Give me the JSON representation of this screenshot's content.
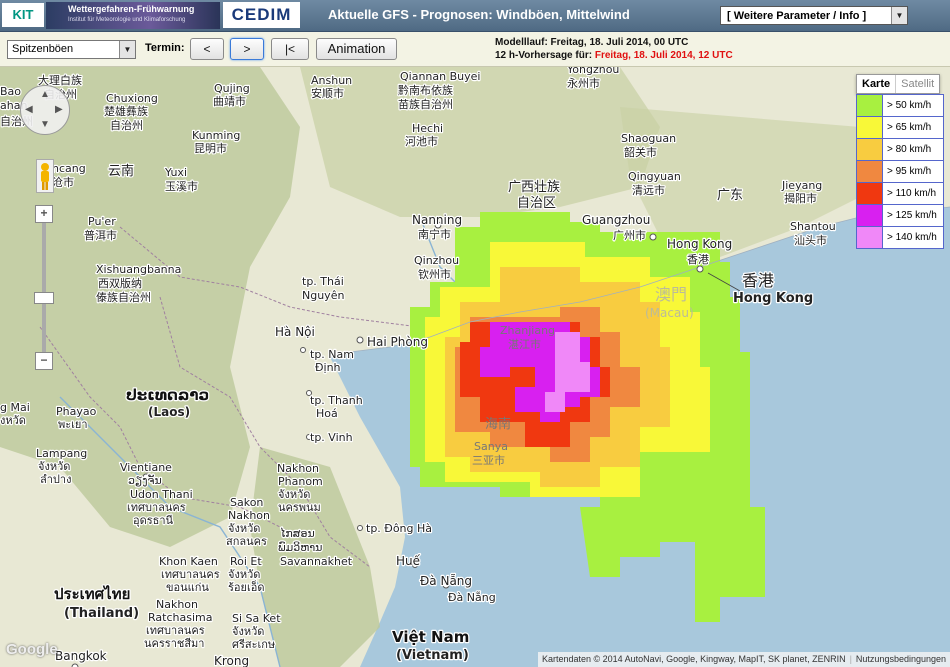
{
  "header": {
    "kit_logo": "KIT",
    "banner_title": "Wettergefahren-Frühwarnung",
    "banner_subtitle": "Institut für Meteorologie und Klimaforschung",
    "cedim_logo": "CEDIM",
    "page_title": "Aktuelle GFS - Prognosen: Windböen, Mittelwind",
    "param_select": "[ Weitere Parameter / Info ]"
  },
  "controls": {
    "variable": "Spitzenböen",
    "termin_label": "Termin:",
    "prev": "<",
    "next": ">",
    "first": "|<",
    "animation": "Animation",
    "run_label": "Modelllauf: Freitag, 18. Juli 2014, 00 UTC",
    "forecast_prefix": "12 h-Vorhersage für:",
    "forecast_time": "Freitag, 18. Juli 2014, 12 UTC"
  },
  "map": {
    "type_tabs": [
      "Karte",
      "Satellit"
    ],
    "zoom_in": "+",
    "zoom_out": "−",
    "google_logo": "Google",
    "attribution": "Kartendaten © 2014 AutoNavi, Google, Kingway, MapIT, SK planet, ZENRIN",
    "terms": "Nutzungsbedingungen",
    "labels": {
      "dali": "大理白族",
      "dali2": "自治州",
      "chuxiong": "Chuxiong",
      "chuxiong2": "楚雄彝族",
      "chuxiong3": "自治州",
      "qujing": "Qujing",
      "qujing2": "曲靖市",
      "kunming": "Kunming",
      "kunming2": "昆明市",
      "anshun": "Anshun",
      "anshun2": "安顺市",
      "qiannan": "Qiannan Buyei",
      "qiannan2": "黔南布依族",
      "qiannan3": "苗族自治州",
      "hechi": "Hechi",
      "hechi2": "河池市",
      "yongzhou": "Yongzhou",
      "yongzhou2": "永州市",
      "shaoguan": "Shaoguan",
      "shaoguan2": "韶关市",
      "qingyuan": "Qingyuan",
      "qingyuan2": "清远市",
      "guangdong": "广东",
      "jieyang": "Jieyang",
      "jieyang2": "揭阳市",
      "shantou": "Shantou",
      "shantou2": "汕头市",
      "yunnan": "云南",
      "yuxi": "Yuxi",
      "yuxi2": "玉溪市",
      "puer": "Pu'er",
      "puer2": "普洱市",
      "cang": "ncang",
      "cang2": "沧市",
      "guangxi": "广西壮族",
      "guangxi2": "自治区",
      "nanning": "Nanning",
      "nanning2": "南宁市",
      "guangzhou": "Guangzhou",
      "guangzhou2": "广州市",
      "hongkong": "Hong Kong",
      "hongkong2": "香港",
      "hongkong_zh": "香港",
      "hongkong_en": "Hong Kong",
      "macau_zh": "澳門",
      "macau_en": "(Macau)",
      "xishuang": "Xishuangbanna",
      "xishuang2": "西双版纳",
      "xishuang3": "傣族自治州",
      "qinzhou": "Qinzhou",
      "qinzhou2": "钦州市",
      "thainguyen": "tp. Thái",
      "thainguyen2": "Nguyên",
      "hanoi": "Hà Nội",
      "haiphong": "Hai Phòng",
      "namdinh": "tp. Nam",
      "namdinh2": "Định",
      "thanhhoa": "tp. Thanh",
      "thanhhoa2": "Hoá",
      "vinh": "tp. Vinh",
      "zhanjiang": "Zhanjiang",
      "zhanjiang2": "湛江市",
      "hainan": "海南",
      "sanya": "Sanya",
      "sanya2": "三亚市",
      "laos": "ປະເທດລາວ",
      "laos2": "(Laos)",
      "phayao": "Phayao",
      "phayao2": "พะเยา",
      "lampang": "Lampang",
      "lampang2": "จังหวัด",
      "lampang3": "ลำปาง",
      "maimai": "g Mai",
      "maimai2": "งหวัด",
      "vientiane": "Vientiane",
      "vientiane2": "ວຽງຈັນ",
      "udon": "Udon Thani",
      "udon2": "เทศบาลนคร",
      "udon3": "อุดรธานี",
      "nakhon": "Nakhon",
      "nakhon2": "Phanom",
      "nakhon3": "จังหวัด",
      "nakhon4": "นครพนม",
      "sakon": "Sakon",
      "sakon2": "Nakhon",
      "sakon3": "จังหวัด",
      "sakon4": "สกลนคร",
      "savannakhet": "ໄກສອນ",
      "savannakhet2": "ພົມວິຫານ",
      "savannakhet3": "Savannakhet",
      "dongha": "tp. Đông Hà",
      "hue": "Huế",
      "danang": "Đà Nẵng",
      "danang2": "Đà Nẵng",
      "khonkaen": "Khon Kaen",
      "khonkaen2": "เทศบาลนคร",
      "khonkaen3": "ขอนแก่น",
      "roiet": "Roi Et",
      "roiet2": "จังหวัด",
      "roiet3": "ร้อยเอ็ด",
      "thailand": "ประเทศไทย",
      "thailand2": "(Thailand)",
      "ratchasima": "Nakhon",
      "ratchasima2": "Ratchasima",
      "ratchasima3": "เทศบาลนคร",
      "ratchasima4": "นครราชสีมา",
      "saket": "Si Sa Ket",
      "saket2": "จังหวัด",
      "saket3": "ศรีสะเกษ",
      "vietnam": "Việt Nam",
      "vietnam2": "(Vietnam)",
      "bangkok": "Bangkok",
      "krong": "Krong",
      "bao": "Bao",
      "bao2": "ahan",
      "bao3": "自治州"
    }
  },
  "legend": [
    {
      "label": "> 50 km/h",
      "color": "#a8f040"
    },
    {
      "label": "> 65 km/h",
      "color": "#f8f838"
    },
    {
      "label": "> 80 km/h",
      "color": "#f8cc40"
    },
    {
      "label": "> 95 km/h",
      "color": "#f08840"
    },
    {
      "label": "> 110 km/h",
      "color": "#f03810"
    },
    {
      "label": "> 125 km/h",
      "color": "#d820f0"
    },
    {
      "label": "> 140 km/h",
      "color": "#f088f8"
    }
  ]
}
